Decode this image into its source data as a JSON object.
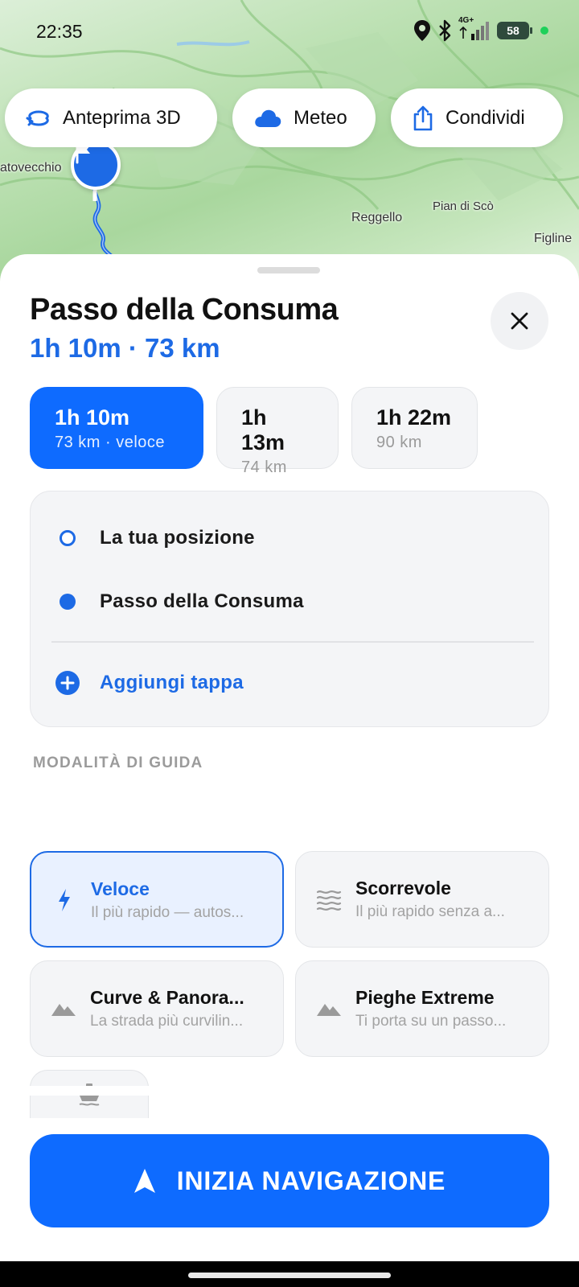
{
  "status_bar": {
    "time": "22:35",
    "network": "4G+",
    "battery": "58"
  },
  "map": {
    "labels": {
      "town_left": "atovecchio",
      "town_reggello": "Reggello",
      "town_pian": "Pian di Scò",
      "town_figline": "Figline"
    }
  },
  "map_actions": {
    "preview_3d": "Anteprima 3D",
    "weather": "Meteo",
    "share": "Condividi"
  },
  "sheet": {
    "title": "Passo della Consuma",
    "summary": "1h 10m · 73 km",
    "routes": [
      {
        "time": "1h 10m",
        "detail": "73 km · veloce",
        "selected": true
      },
      {
        "time": "1h 13m",
        "detail": "74 km",
        "selected": false
      },
      {
        "time": "1h 22m",
        "detail": "90 km",
        "selected": false
      }
    ],
    "stops": {
      "origin": "La tua posizione",
      "destination": "Passo della Consuma",
      "add_stop": "Aggiungi tappa"
    },
    "driving_mode_label": "MODALITÀ DI GUIDA",
    "modes": [
      {
        "name": "Veloce",
        "desc": "Il più rapido — autos...",
        "icon": "lightning-icon",
        "selected": true
      },
      {
        "name": "Scorrevole",
        "desc": "Il più rapido senza a...",
        "icon": "waves-icon",
        "selected": false
      },
      {
        "name": "Curve & Panora...",
        "desc": "La strada più curvilin...",
        "icon": "mountain-icon",
        "selected": false
      },
      {
        "name": "Pieghe Extreme",
        "desc": "Ti porta su un passo...",
        "icon": "mountain-icon",
        "selected": false
      }
    ],
    "partial_mode_icon": "ferry-icon",
    "start_button": "INIZIA NAVIGAZIONE"
  },
  "colors": {
    "accent": "#0e6bff",
    "accent_text": "#1d6ae5",
    "selected_bg": "#e9f1ff"
  }
}
